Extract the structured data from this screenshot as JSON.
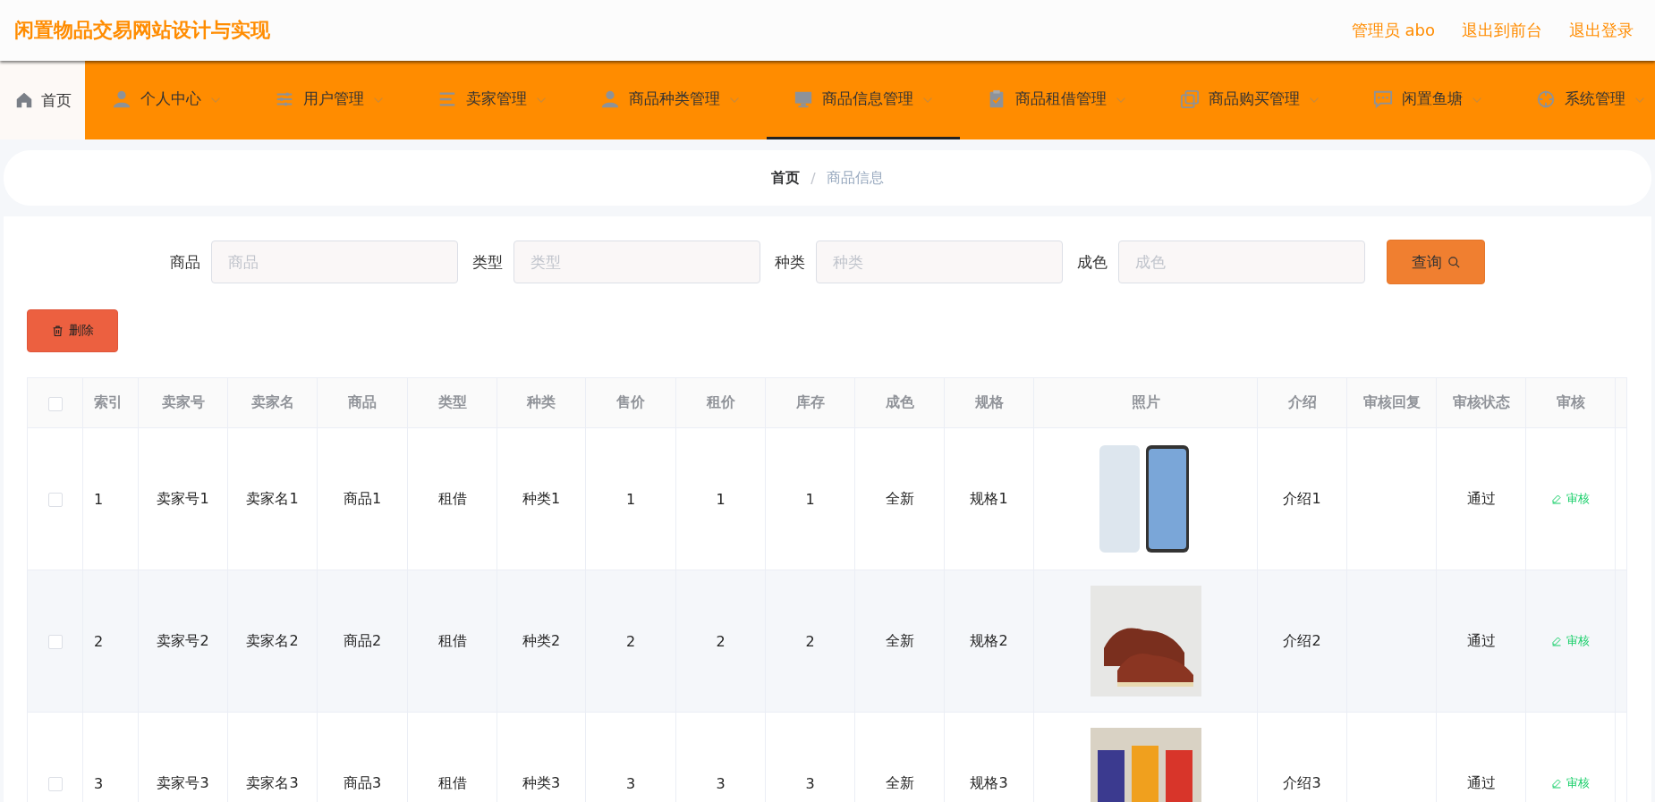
{
  "header": {
    "title": "闲置物品交易网站设计与实现",
    "links": [
      "管理员 abo",
      "退出到前台",
      "退出登录"
    ]
  },
  "nav": {
    "home": "首页",
    "items": [
      {
        "label": "个人中心",
        "selected": false
      },
      {
        "label": "用户管理",
        "selected": false
      },
      {
        "label": "卖家管理",
        "selected": false
      },
      {
        "label": "商品种类管理",
        "selected": false
      },
      {
        "label": "商品信息管理",
        "selected": true
      },
      {
        "label": "商品租借管理",
        "selected": false
      },
      {
        "label": "商品购买管理",
        "selected": false
      },
      {
        "label": "闲置鱼塘",
        "selected": false
      },
      {
        "label": "系统管理",
        "selected": false
      }
    ]
  },
  "breadcrumb": [
    "首页",
    "商品信息"
  ],
  "breadcrumb_separator": "/",
  "filters": [
    {
      "label": "商品",
      "placeholder": "商品"
    },
    {
      "label": "类型",
      "placeholder": "类型"
    },
    {
      "label": "种类",
      "placeholder": "种类"
    },
    {
      "label": "成色",
      "placeholder": "成色"
    }
  ],
  "search_button": "查询",
  "delete_button": "删除",
  "table": {
    "header_checked": false,
    "columns": [
      "索引",
      "卖家号",
      "卖家名",
      "商品",
      "类型",
      "种类",
      "售价",
      "租价",
      "库存",
      "成色",
      "规格",
      "照片",
      "介绍",
      "审核回复",
      "审核状态",
      "审核"
    ],
    "rows": [
      {
        "checked": false,
        "cells": [
          "1",
          "卖家号1",
          "卖家名1",
          "商品1",
          "租借",
          "种类1",
          "1",
          "1",
          "1",
          "全新",
          "规格1"
        ],
        "intro": "介绍1",
        "status": "通过",
        "action": "审核"
      },
      {
        "checked": false,
        "cells": [
          "2",
          "卖家号2",
          "卖家名2",
          "商品2",
          "租借",
          "种类2",
          "2",
          "2",
          "2",
          "全新",
          "规格2"
        ],
        "intro": "介绍2",
        "status": "通过",
        "action": "审核"
      },
      {
        "checked": false,
        "cells": [
          "3",
          "卖家号3",
          "卖家名3",
          "商品3",
          "租借",
          "种类3",
          "3",
          "3",
          "3",
          "全新",
          "规格3"
        ],
        "intro": "介绍3",
        "status": "通过",
        "action": "审核"
      }
    ]
  }
}
